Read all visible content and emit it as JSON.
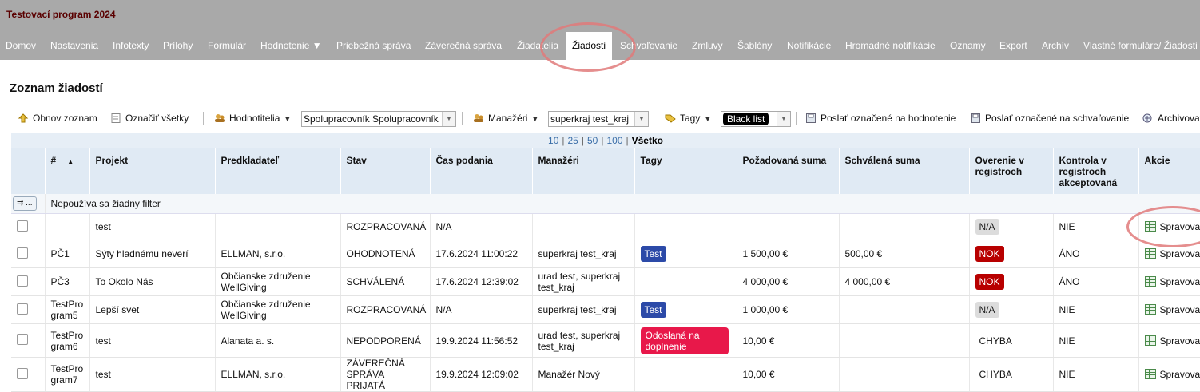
{
  "app": {
    "title": "Testovací program 2024"
  },
  "nav": [
    "Domov",
    "Nastavenia",
    "Infotexty",
    "Prílohy",
    "Formulár",
    "Hodnotenie ▼",
    "Priebežná správa",
    "Záverečná správa",
    "Žiadatelia",
    "Žiadosti",
    "Schvaľovanie",
    "Zmluvy",
    "Šablóny",
    "Notifikácie",
    "Hromadné notifikácie",
    "Oznamy",
    "Export",
    "Archív",
    "Vlastné formuláre/ Žiadosti"
  ],
  "nav_active": "Žiadosti",
  "page": {
    "title": "Zoznam žiadostí"
  },
  "toolbar": {
    "refresh": "Obnov zoznam",
    "select_all": "Označiť všetky",
    "evaluators": "Hodnotitelia",
    "evaluators_value": "Spolupracovník Spolupracovník",
    "managers": "Manažéri",
    "managers_value": "superkraj test_kraj",
    "tags": "Tagy",
    "tags_value": "Black list",
    "send_eval": "Poslať označené na hodnotenie",
    "send_approve": "Poslať označené na schvaľovanie",
    "archive": "Archivovať"
  },
  "pager": {
    "sizes": [
      "10",
      "25",
      "50",
      "100"
    ],
    "all": "Všetko"
  },
  "columns": [
    "#",
    "Projekt",
    "Predkladateľ",
    "Stav",
    "Čas podania",
    "Manažéri",
    "Tagy",
    "Požadovaná suma",
    "Schválená suma",
    "Overenie v registroch",
    "Kontrola v registroch akceptovaná",
    "Akcie"
  ],
  "filter_text": "Nepoužíva sa žiadny filter",
  "filter_button": "⇉ ...",
  "action_label": "Spravovať",
  "rows": [
    {
      "id": "",
      "project": "test",
      "applicant": "",
      "status": "ROZPRACOVANÁ",
      "time": "N/A",
      "managers": "",
      "tag": "",
      "tag_style": "",
      "req": "",
      "appr": "",
      "verify": "N/A",
      "verify_style": "gray",
      "control": "NIE"
    },
    {
      "id": "PČ1",
      "project": "Sýty hladnému neverí",
      "applicant": "ELLMAN, s.r.o.",
      "status": "OHODNOTENÁ",
      "time": "17.6.2024 11:00:22",
      "managers": "superkraj test_kraj",
      "tag": "Test",
      "tag_style": "blue",
      "req": "1 500,00 €",
      "appr": "500,00 €",
      "verify": "NOK",
      "verify_style": "nok",
      "control": "ÁNO"
    },
    {
      "id": "PČ3",
      "project": "To Okolo Nás",
      "applicant": "Občianske združenie WellGiving",
      "status": "SCHVÁLENÁ",
      "time": "17.6.2024 12:39:02",
      "managers": "urad test, superkraj test_kraj",
      "tag": "",
      "tag_style": "",
      "req": "4 000,00 €",
      "appr": "4 000,00 €",
      "verify": "NOK",
      "verify_style": "nok",
      "control": "ÁNO"
    },
    {
      "id": "TestProgram5",
      "project": "Lepší svet",
      "applicant": "Občianske združenie WellGiving",
      "status": "ROZPRACOVANÁ",
      "time": "N/A",
      "managers": "superkraj test_kraj",
      "tag": "Test",
      "tag_style": "blue",
      "req": "1 000,00 €",
      "appr": "",
      "verify": "N/A",
      "verify_style": "gray",
      "control": "NIE"
    },
    {
      "id": "TestProgram6",
      "project": "test",
      "applicant": "Alanata a. s.",
      "status": "NEPODPORENÁ",
      "time": "19.9.2024 11:56:52",
      "managers": "urad test, superkraj test_kraj",
      "tag": "Odoslaná na doplnenie",
      "tag_style": "red",
      "req": "10,00 €",
      "appr": "",
      "verify": "CHYBA",
      "verify_style": "",
      "control": "NIE"
    },
    {
      "id": "TestProgram7",
      "project": "test",
      "applicant": "ELLMAN, s.r.o.",
      "status": "ZÁVEREČNÁ SPRÁVA PRIJATÁ",
      "time": "19.9.2024 12:09:02",
      "managers": "Manažér Nový",
      "tag": "",
      "tag_style": "",
      "req": "10,00 €",
      "appr": "",
      "verify": "CHYBA",
      "verify_style": "",
      "control": "NIE"
    }
  ]
}
